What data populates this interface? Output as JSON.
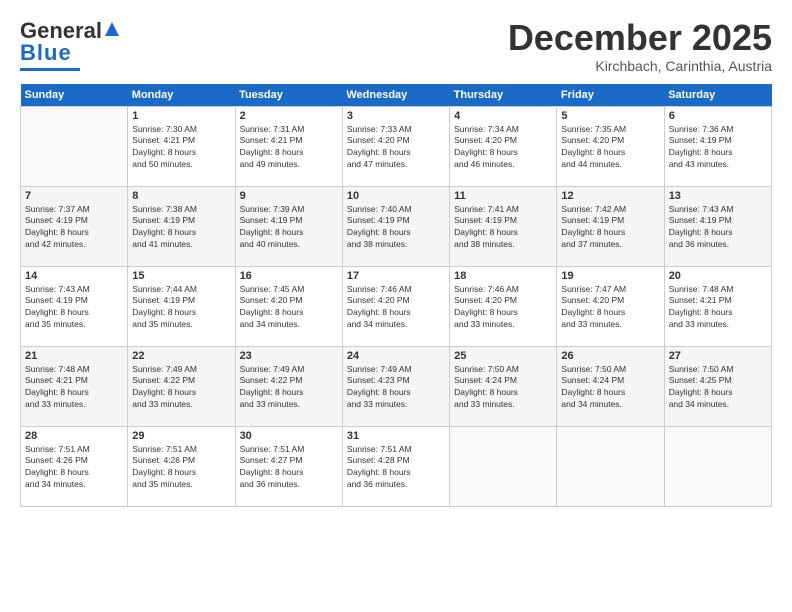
{
  "logo": {
    "line1": "General",
    "line2": "Blue"
  },
  "header": {
    "month": "December 2025",
    "location": "Kirchbach, Carinthia, Austria"
  },
  "weekdays": [
    "Sunday",
    "Monday",
    "Tuesday",
    "Wednesday",
    "Thursday",
    "Friday",
    "Saturday"
  ],
  "weeks": [
    [
      {
        "num": "",
        "info": ""
      },
      {
        "num": "1",
        "info": "Sunrise: 7:30 AM\nSunset: 4:21 PM\nDaylight: 8 hours\nand 50 minutes."
      },
      {
        "num": "2",
        "info": "Sunrise: 7:31 AM\nSunset: 4:21 PM\nDaylight: 8 hours\nand 49 minutes."
      },
      {
        "num": "3",
        "info": "Sunrise: 7:33 AM\nSunset: 4:20 PM\nDaylight: 8 hours\nand 47 minutes."
      },
      {
        "num": "4",
        "info": "Sunrise: 7:34 AM\nSunset: 4:20 PM\nDaylight: 8 hours\nand 46 minutes."
      },
      {
        "num": "5",
        "info": "Sunrise: 7:35 AM\nSunset: 4:20 PM\nDaylight: 8 hours\nand 44 minutes."
      },
      {
        "num": "6",
        "info": "Sunrise: 7:36 AM\nSunset: 4:19 PM\nDaylight: 8 hours\nand 43 minutes."
      }
    ],
    [
      {
        "num": "7",
        "info": "Sunrise: 7:37 AM\nSunset: 4:19 PM\nDaylight: 8 hours\nand 42 minutes."
      },
      {
        "num": "8",
        "info": "Sunrise: 7:38 AM\nSunset: 4:19 PM\nDaylight: 8 hours\nand 41 minutes."
      },
      {
        "num": "9",
        "info": "Sunrise: 7:39 AM\nSunset: 4:19 PM\nDaylight: 8 hours\nand 40 minutes."
      },
      {
        "num": "10",
        "info": "Sunrise: 7:40 AM\nSunset: 4:19 PM\nDaylight: 8 hours\nand 38 minutes."
      },
      {
        "num": "11",
        "info": "Sunrise: 7:41 AM\nSunset: 4:19 PM\nDaylight: 8 hours\nand 38 minutes."
      },
      {
        "num": "12",
        "info": "Sunrise: 7:42 AM\nSunset: 4:19 PM\nDaylight: 8 hours\nand 37 minutes."
      },
      {
        "num": "13",
        "info": "Sunrise: 7:43 AM\nSunset: 4:19 PM\nDaylight: 8 hours\nand 36 minutes."
      }
    ],
    [
      {
        "num": "14",
        "info": "Sunrise: 7:43 AM\nSunset: 4:19 PM\nDaylight: 8 hours\nand 35 minutes."
      },
      {
        "num": "15",
        "info": "Sunrise: 7:44 AM\nSunset: 4:19 PM\nDaylight: 8 hours\nand 35 minutes."
      },
      {
        "num": "16",
        "info": "Sunrise: 7:45 AM\nSunset: 4:20 PM\nDaylight: 8 hours\nand 34 minutes."
      },
      {
        "num": "17",
        "info": "Sunrise: 7:46 AM\nSunset: 4:20 PM\nDaylight: 8 hours\nand 34 minutes."
      },
      {
        "num": "18",
        "info": "Sunrise: 7:46 AM\nSunset: 4:20 PM\nDaylight: 8 hours\nand 33 minutes."
      },
      {
        "num": "19",
        "info": "Sunrise: 7:47 AM\nSunset: 4:20 PM\nDaylight: 8 hours\nand 33 minutes."
      },
      {
        "num": "20",
        "info": "Sunrise: 7:48 AM\nSunset: 4:21 PM\nDaylight: 8 hours\nand 33 minutes."
      }
    ],
    [
      {
        "num": "21",
        "info": "Sunrise: 7:48 AM\nSunset: 4:21 PM\nDaylight: 8 hours\nand 33 minutes."
      },
      {
        "num": "22",
        "info": "Sunrise: 7:49 AM\nSunset: 4:22 PM\nDaylight: 8 hours\nand 33 minutes."
      },
      {
        "num": "23",
        "info": "Sunrise: 7:49 AM\nSunset: 4:22 PM\nDaylight: 8 hours\nand 33 minutes."
      },
      {
        "num": "24",
        "info": "Sunrise: 7:49 AM\nSunset: 4:23 PM\nDaylight: 8 hours\nand 33 minutes."
      },
      {
        "num": "25",
        "info": "Sunrise: 7:50 AM\nSunset: 4:24 PM\nDaylight: 8 hours\nand 33 minutes."
      },
      {
        "num": "26",
        "info": "Sunrise: 7:50 AM\nSunset: 4:24 PM\nDaylight: 8 hours\nand 34 minutes."
      },
      {
        "num": "27",
        "info": "Sunrise: 7:50 AM\nSunset: 4:25 PM\nDaylight: 8 hours\nand 34 minutes."
      }
    ],
    [
      {
        "num": "28",
        "info": "Sunrise: 7:51 AM\nSunset: 4:26 PM\nDaylight: 8 hours\nand 34 minutes."
      },
      {
        "num": "29",
        "info": "Sunrise: 7:51 AM\nSunset: 4:26 PM\nDaylight: 8 hours\nand 35 minutes."
      },
      {
        "num": "30",
        "info": "Sunrise: 7:51 AM\nSunset: 4:27 PM\nDaylight: 8 hours\nand 36 minutes."
      },
      {
        "num": "31",
        "info": "Sunrise: 7:51 AM\nSunset: 4:28 PM\nDaylight: 8 hours\nand 36 minutes."
      },
      {
        "num": "",
        "info": ""
      },
      {
        "num": "",
        "info": ""
      },
      {
        "num": "",
        "info": ""
      }
    ]
  ]
}
